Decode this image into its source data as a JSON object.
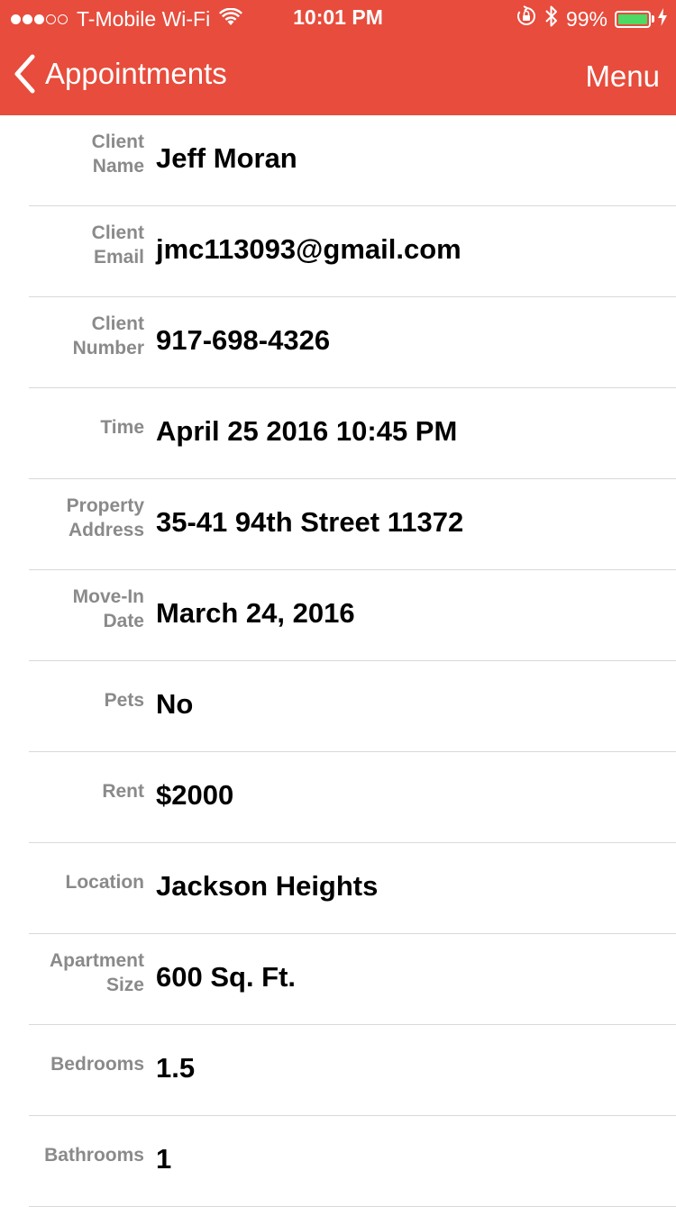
{
  "status_bar": {
    "signal_dots": [
      "full",
      "full",
      "full",
      "empty",
      "empty"
    ],
    "carrier": "T-Mobile Wi-Fi",
    "wifi_icon": "wifi-icon",
    "time": "10:01 PM",
    "lock_icon": "rotation-lock-icon",
    "bluetooth_icon": "bluetooth-icon",
    "battery_percent": "99%",
    "battery_level": 0.99,
    "charging_icon": "bolt-icon"
  },
  "nav": {
    "back_label": "Appointments",
    "menu_label": "Menu"
  },
  "colors": {
    "accent": "#e74c3c",
    "label": "#8a8a8a",
    "value": "#000000",
    "separator": "#d9d9d9",
    "battery": "#4cd964"
  },
  "fields": [
    {
      "label": "Client Name",
      "label_lines": [
        "Client",
        "Name"
      ],
      "value": "Jeff Moran"
    },
    {
      "label": "Client Email",
      "label_lines": [
        "Client",
        "Email"
      ],
      "value": "jmc113093@gmail.com"
    },
    {
      "label": "Client Number",
      "label_lines": [
        "Client",
        "Number"
      ],
      "value": "917-698-4326"
    },
    {
      "label": "Time",
      "label_lines": [
        "Time"
      ],
      "value": "April 25 2016 10:45 PM"
    },
    {
      "label": "Property Address",
      "label_lines": [
        "Property",
        "Address"
      ],
      "value": "35-41 94th Street 11372"
    },
    {
      "label": "Move-In Date",
      "label_lines": [
        "Move-In",
        "Date"
      ],
      "value": "March 24, 2016"
    },
    {
      "label": "Pets",
      "label_lines": [
        "Pets"
      ],
      "value": "No"
    },
    {
      "label": "Rent",
      "label_lines": [
        "Rent"
      ],
      "value": "$2000"
    },
    {
      "label": "Location",
      "label_lines": [
        "Location"
      ],
      "value": "Jackson Heights"
    },
    {
      "label": "Apartment Size",
      "label_lines": [
        "Apartment",
        "Size"
      ],
      "value": "600 Sq. Ft."
    },
    {
      "label": "Bedrooms",
      "label_lines": [
        "Bedrooms"
      ],
      "value": "1.5"
    },
    {
      "label": "Bathrooms",
      "label_lines": [
        "Bathrooms"
      ],
      "value": "1"
    }
  ]
}
